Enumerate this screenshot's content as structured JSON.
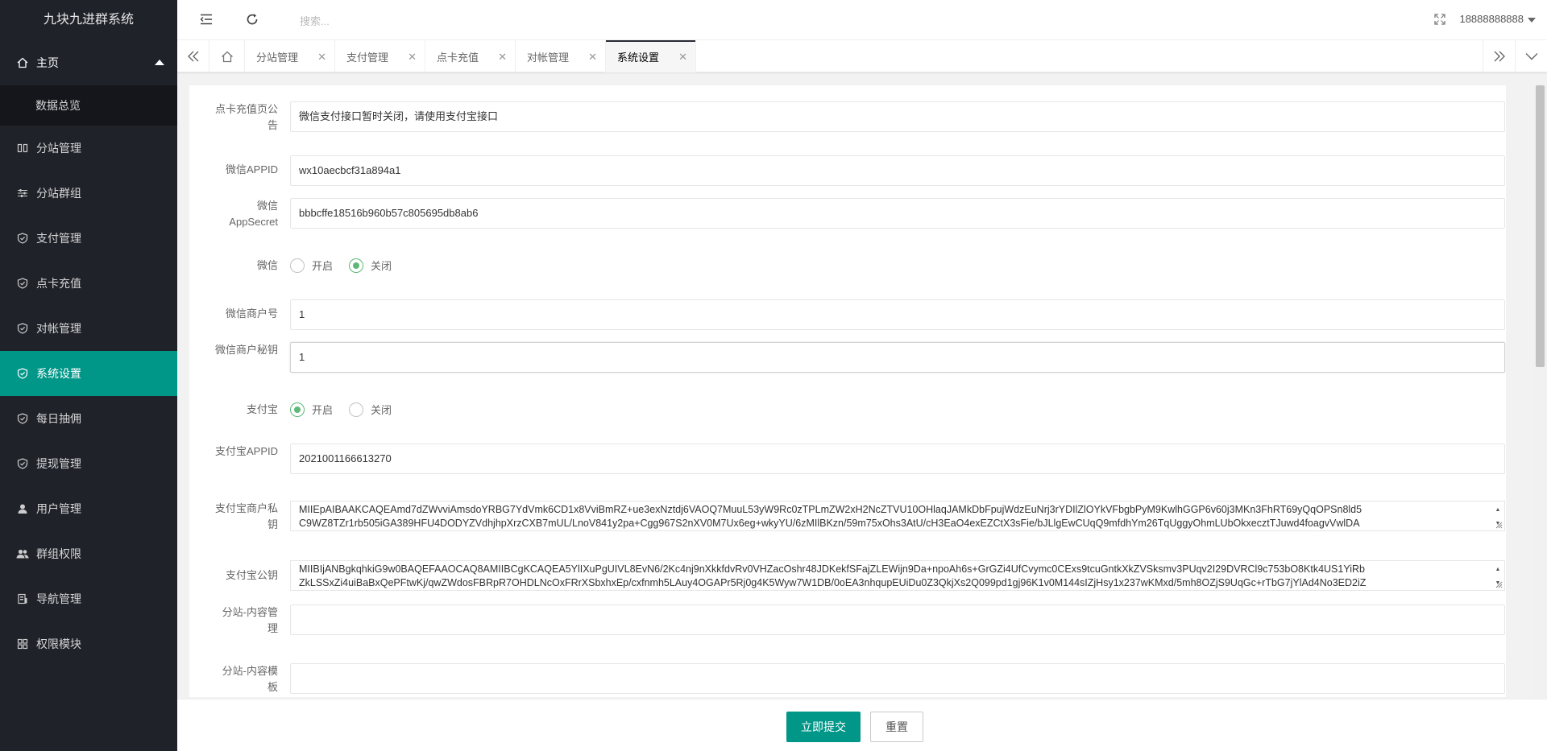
{
  "app": {
    "title": "九块九进群系统"
  },
  "sidebar": {
    "items": [
      {
        "label": "主页",
        "icon": "home-icon"
      },
      {
        "label": "数据总览"
      },
      {
        "label": "分站管理",
        "icon": "columns-icon"
      },
      {
        "label": "分站群组",
        "icon": "sliders-icon"
      },
      {
        "label": "支付管理",
        "icon": "shield-check-icon"
      },
      {
        "label": "点卡充值",
        "icon": "shield-check-icon"
      },
      {
        "label": "对帐管理",
        "icon": "shield-check-icon"
      },
      {
        "label": "系统设置",
        "icon": "shield-check-icon"
      },
      {
        "label": "每日抽佣",
        "icon": "shield-check-icon"
      },
      {
        "label": "提现管理",
        "icon": "shield-check-icon"
      },
      {
        "label": "用户管理",
        "icon": "user-icon"
      },
      {
        "label": "群组权限",
        "icon": "users-icon"
      },
      {
        "label": "导航管理",
        "icon": "server-icon"
      },
      {
        "label": "权限模块",
        "icon": "grid-icon"
      }
    ]
  },
  "topbar": {
    "search_placeholder": "搜索...",
    "username": "18888888888"
  },
  "tabs": [
    {
      "label": "分站管理"
    },
    {
      "label": "支付管理"
    },
    {
      "label": "点卡充值"
    },
    {
      "label": "对帐管理"
    },
    {
      "label": "系统设置"
    }
  ],
  "form": {
    "notice": {
      "label": "点卡充值页公告",
      "value": "微信支付接口暂时关闭，请使用支付宝接口"
    },
    "wx_appid": {
      "label": "微信APPID",
      "value": "wx10aecbcf31a894a1"
    },
    "wx_secret": {
      "label": "微信AppSecret",
      "value": "bbbcffe18516b960b57c805695db8ab6"
    },
    "wx_switch": {
      "label": "微信",
      "on": "开启",
      "off": "关闭",
      "selected": "off"
    },
    "wx_mchid": {
      "label": "微信商户号",
      "value": "1"
    },
    "wx_mchkey": {
      "label": "微信商户秘钥",
      "value": "1"
    },
    "ali_switch": {
      "label": "支付宝",
      "on": "开启",
      "off": "关闭",
      "selected": "on"
    },
    "ali_appid": {
      "label": "支付宝APPID",
      "value": "2021001166613270"
    },
    "ali_private_key": {
      "label": "支付宝商户私钥",
      "line1": "MIIEpAIBAAKCAQEAmd7dZWvviAmsdoYRBG7YdVmk6CD1x8VviBmRZ+ue3exNztdj6VAOQ7MuuL53yW9Rc0zTPLmZW2xH2NcZTVU10OHlaqJAMkDbFpujWdzEuNrj3rYDIlZlOYkVFbgbPyM9KwlhGGP6v60j3MKn3FhRT69yQqOPSn8ld5",
      "line2": "C9WZ8TZr1rb505iGA389HFU4DODYZVdhjhpXrzCXB7mUL/LnoV841y2pa+Cgg967S2nXV0M7Ux6eg+wkyYU/6zMIlBKzn/59m75xOhs3AtU/cH3EaO4exEZCtX3sFie/bJLlgEwCUqQ9mfdhYm26TqUggyOhmLUbOkxecztTJuwd4foagvVwlDA"
    },
    "ali_public_key": {
      "label": "支付宝公钥",
      "line1": "MIIBIjANBgkqhkiG9w0BAQEFAAOCAQ8AMIIBCgKCAQEA5YlIXuPgUIVL8EvN6/2Kc4nj9nXkkfdvRv0VHZacOshr48JDKekfSFajZLEWijn9Da+npoAh6s+GrGZi4UfCvymc0CExs9tcuGntkXkZVSksmv3PUqv2I29DVRCl9c753bO8Ktk4US1YiRb",
      "line2": "ZkLSSxZi4uiBaBxQePFtwKj/qwZWdosFBRpR7OHDLNcOxFRrXSbxhxEp/cxfnmh5LAuy4OGAPr5Rj0g4K5Wyw7W1DB/0oEA3nhqupEUiDu0Z3QkjXs2Q099pd1gj96K1v0M144sIZjHsy1x237wKMxd/5mh8OZjS9UqGc+rTbG7jYlAd4No3ED2iZ"
    },
    "sub_content_manage": {
      "label": "分站-内容管理",
      "value": ""
    },
    "sub_content_template": {
      "label": "分站-内容模板",
      "value": ""
    }
  },
  "footer": {
    "submit_label": "立即提交",
    "reset_label": "重置"
  },
  "colors": {
    "accent": "#009688",
    "sidebar_bg": "#20222a",
    "radio_checked": "#5fb878"
  }
}
